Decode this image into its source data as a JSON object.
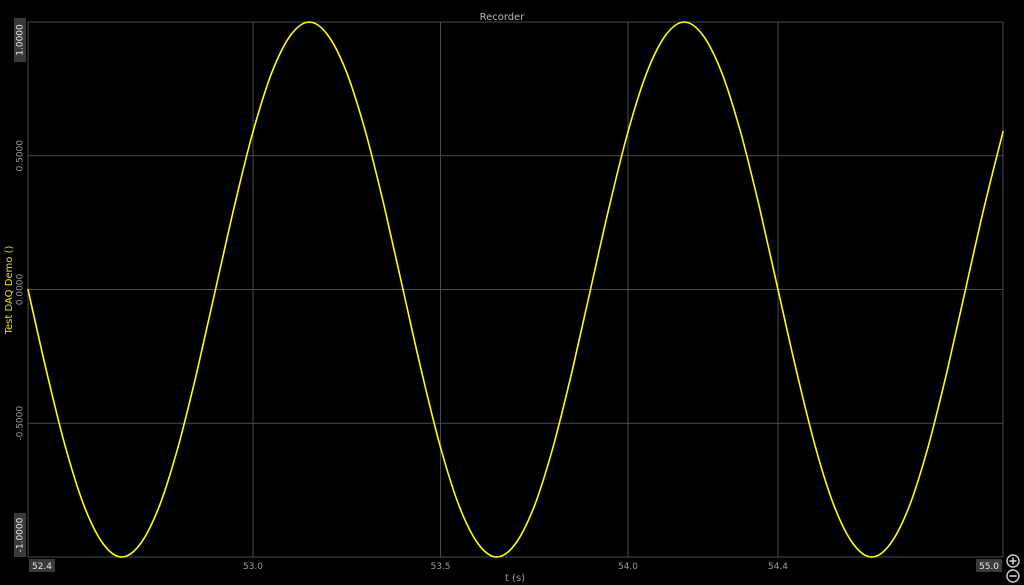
{
  "window": {
    "title": "Recorder"
  },
  "colors": {
    "background": "#000000",
    "grid": "#4a4a4a",
    "trace": "#ffff00",
    "axis_text": "#9a9a9a",
    "ylabel": "#e6e600",
    "end_label_bg": "#3a3a3a"
  },
  "zoom": {
    "in_icon": "zoom-in-icon",
    "out_icon": "zoom-out-icon"
  },
  "chart_data": {
    "type": "line",
    "title": "Recorder",
    "xlabel": "t (s)",
    "ylabel": "Test DAQ Demo ()",
    "xlim": [
      52.4,
      55.0
    ],
    "ylim": [
      -1.0,
      1.0
    ],
    "grid": true,
    "x_start_label": "52.4",
    "x_end_label": "55.0",
    "x_ticks": [
      {
        "value": 53.0,
        "label": "53.0"
      },
      {
        "value": 53.5,
        "label": "53.5"
      },
      {
        "value": 54.0,
        "label": "54.0"
      },
      {
        "value": 54.4,
        "label": "54.4"
      }
    ],
    "y_ticks": [
      {
        "value": 1.0,
        "label": "1.0000"
      },
      {
        "value": 0.5,
        "label": "0.5000"
      },
      {
        "value": 0.0,
        "label": "0.0000"
      },
      {
        "value": -0.5,
        "label": "-0.5000"
      },
      {
        "value": -1.0,
        "label": "-1.0000"
      }
    ],
    "series": [
      {
        "color": "#ffff00",
        "x": [
          52.4,
          52.45,
          52.5,
          52.55,
          52.6,
          52.65,
          52.7,
          52.75,
          52.8,
          52.85,
          52.9,
          52.95,
          53.0,
          53.05,
          53.1,
          53.15,
          53.2,
          53.25,
          53.3,
          53.35,
          53.4,
          53.45,
          53.5,
          53.55,
          53.6,
          53.65,
          53.7,
          53.75,
          53.8,
          53.85,
          53.9,
          53.95,
          54.0,
          54.05,
          54.1,
          54.15,
          54.2,
          54.25,
          54.3,
          54.35,
          54.4,
          54.45,
          54.5,
          54.55,
          54.6,
          54.65,
          54.7,
          54.75,
          54.8,
          54.85,
          54.9,
          54.95,
          55.0
        ],
        "y": [
          0.0,
          -0.31,
          -0.59,
          -0.81,
          -0.95,
          -1.0,
          -0.95,
          -0.81,
          -0.59,
          -0.31,
          0.0,
          0.31,
          0.59,
          0.81,
          0.95,
          1.0,
          0.95,
          0.81,
          0.59,
          0.31,
          0.0,
          -0.31,
          -0.59,
          -0.81,
          -0.95,
          -1.0,
          -0.95,
          -0.81,
          -0.59,
          -0.31,
          0.0,
          0.31,
          0.59,
          0.81,
          0.95,
          1.0,
          0.95,
          0.81,
          0.59,
          0.31,
          0.0,
          -0.31,
          -0.59,
          -0.81,
          -0.95,
          -1.0,
          -0.95,
          -0.81,
          -0.59,
          -0.31,
          0.0,
          0.31,
          0.59
        ]
      }
    ]
  }
}
